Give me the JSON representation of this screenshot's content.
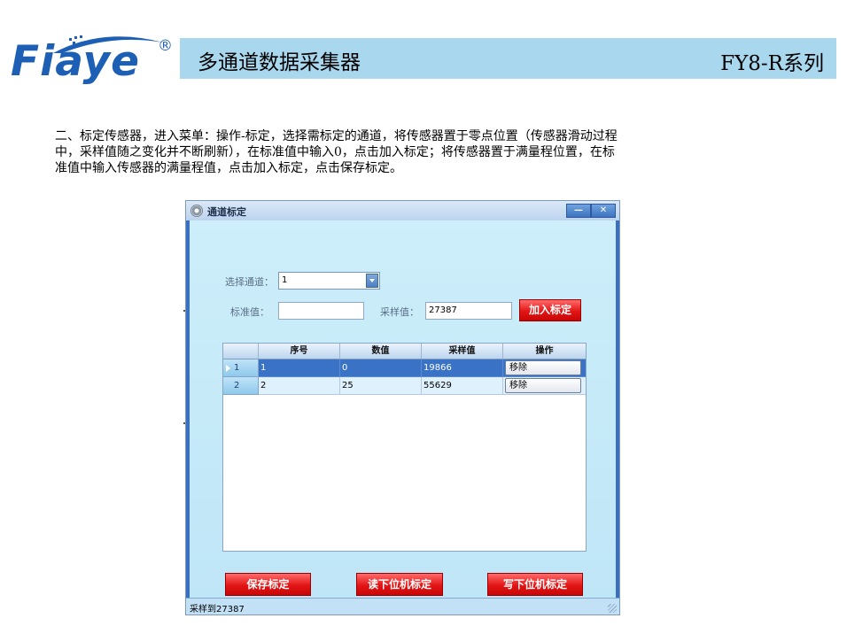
{
  "brand": {
    "logo_text": "Fiaye",
    "registered_mark": "®"
  },
  "header": {
    "title": "多通道数据采集器",
    "series": "FY8-R系列"
  },
  "description": [
    "二、标定传感器，进入菜单：操作-标定，选择需标定的通道，将传感器置于零点位置（传感器滑动过程",
    "中，采样值随之变化并不断刷新），在标准值中输入0，点击加入标定；将传感器置于满量程位置，在标",
    "准值中输入传感器的满量程值，点击加入标定，点击保存标定。"
  ],
  "window": {
    "title": "通道标定",
    "minimize_glyph": "—",
    "close_glyph": "✕",
    "channel_label": "选择通道：",
    "channel_value": "1",
    "standard_label": "标准值：",
    "standard_value": "",
    "sample_label": "采样值：",
    "sample_value": "27387",
    "add_button": "加入标定",
    "table": {
      "columns": [
        "",
        "序号",
        "数值",
        "采样值",
        "操作"
      ],
      "rows": [
        {
          "header": "1",
          "seq": "1",
          "value": "0",
          "sample": "19866",
          "action": "移除"
        },
        {
          "header": "2",
          "seq": "2",
          "value": "25",
          "sample": "55629",
          "action": "移除"
        }
      ]
    },
    "save_button": "保存标定",
    "read_button": "读下位机标定",
    "write_button": "写下位机标定",
    "status": "采样到27387"
  },
  "colors": {
    "brand_blue": "#1d5fb4",
    "header_band": "#a8d7ee",
    "accent_red": "#e21515",
    "selection_blue": "#3a72c5"
  }
}
